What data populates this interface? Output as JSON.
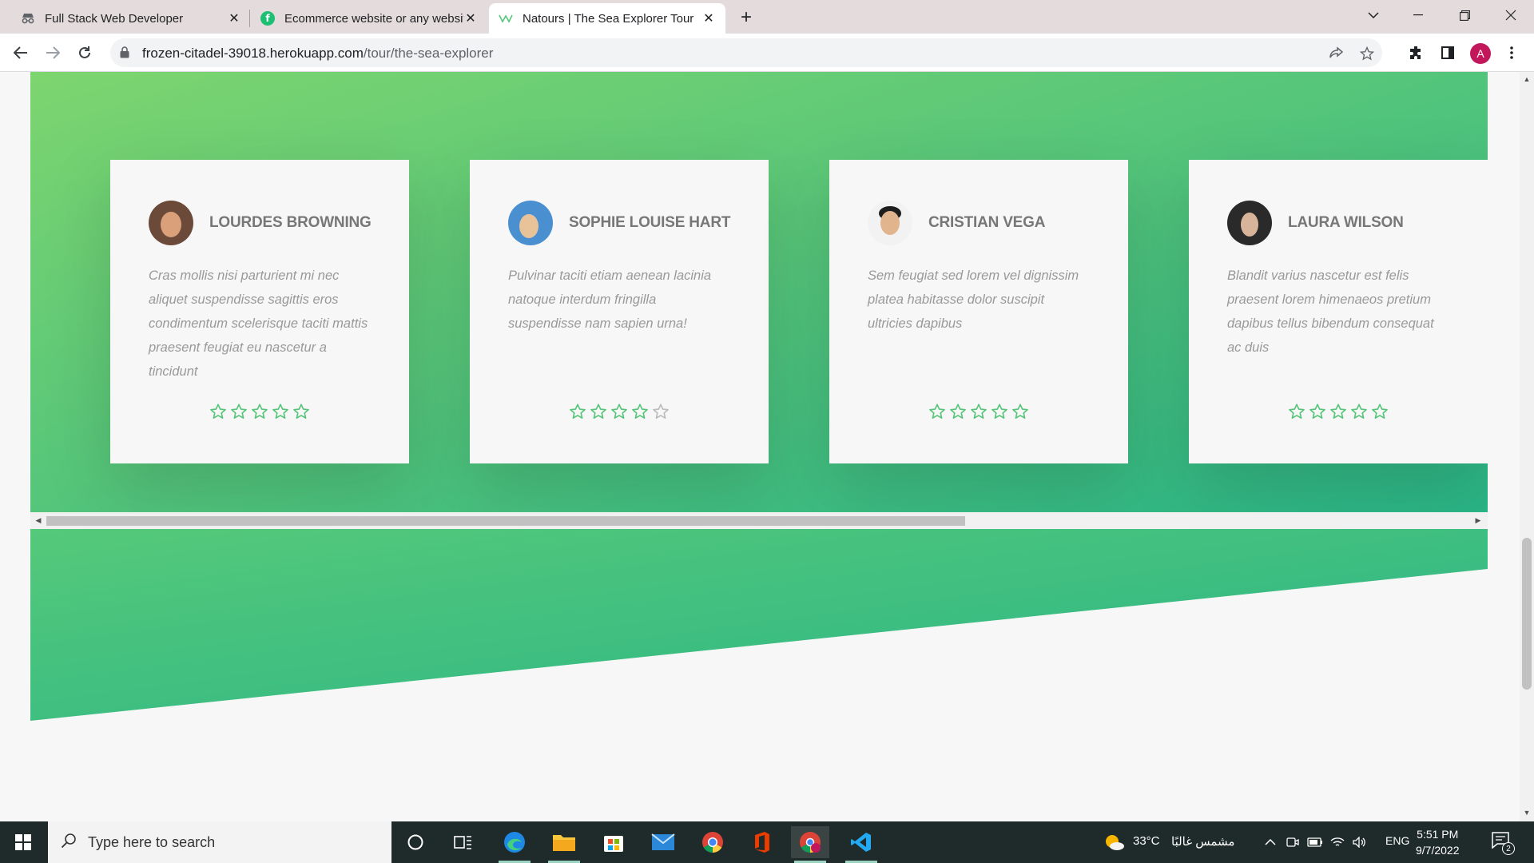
{
  "browser": {
    "tabs": [
      {
        "title": "Full Stack Web Developer",
        "icon": "incognito-icon",
        "active": false
      },
      {
        "title": "Ecommerce website or any website",
        "icon": "fiverr-icon",
        "active": false
      },
      {
        "title": "Natours | The Sea Explorer Tour",
        "icon": "natours-logo-icon",
        "active": true
      }
    ],
    "url_domain": "frozen-citadel-39018.herokuapp.com",
    "url_path": "/tour/the-sea-explorer",
    "profile_initial": "A"
  },
  "reviews": [
    {
      "name": "Lourdes Browning",
      "text": "Cras mollis nisi parturient mi nec aliquet suspendisse sagittis eros condimentum scelerisque taciti mattis praesent feugiat eu nascetur a tincidunt",
      "rating": 5,
      "avatar_colors": [
        "#6b4a3a",
        "#d9a07a"
      ]
    },
    {
      "name": "Sophie Louise Hart",
      "text": "Pulvinar taciti etiam aenean lacinia natoque interdum fringilla suspendisse nam sapien urna!",
      "rating": 4,
      "avatar_colors": [
        "#4a8fd0",
        "#e8c39a"
      ]
    },
    {
      "name": "Cristian Vega",
      "text": "Sem feugiat sed lorem vel dignissim platea habitasse dolor suscipit ultricies dapibus",
      "rating": 5,
      "avatar_colors": [
        "#1d1d1d",
        "#e2b48e"
      ]
    },
    {
      "name": "Laura Wilson",
      "text": "Blandit varius nascetur est felis praesent lorem himenaeos pretium dapibus tellus bibendum consequat ac duis",
      "rating": 5,
      "avatar_colors": [
        "#2a2a2a",
        "#d8b49a"
      ]
    }
  ],
  "colors": {
    "accent_green": "#55c57a",
    "star_empty": "#bbbbbb"
  },
  "taskbar": {
    "search_placeholder": "Type here to search",
    "weather_temp": "33°C",
    "weather_text": "مشمس غالبًا",
    "language": "ENG",
    "time": "5:51 PM",
    "date": "9/7/2022",
    "notification_count": "2"
  }
}
